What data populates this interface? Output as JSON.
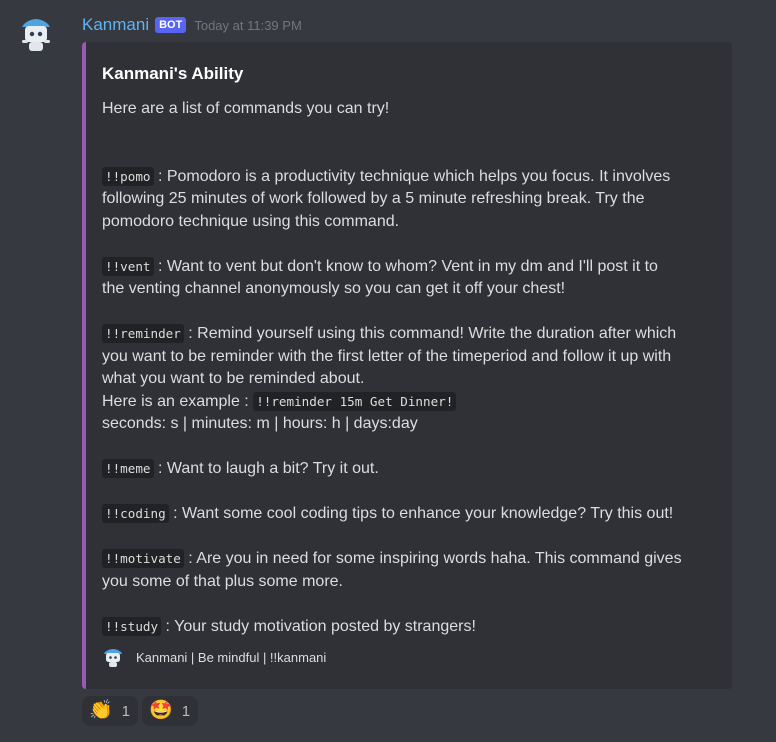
{
  "message": {
    "username": "Kanmani",
    "bot_tag": "BOT",
    "timestamp": "Today at 11:39 PM"
  },
  "embed": {
    "accent_color": "#9b59b6",
    "title": "Kanmani's Ability",
    "intro": "Here are a list of commands you can try!",
    "commands": [
      {
        "command": "!!pomo",
        "lines": [
          " : Pomodoro is a productivity technique which helps you focus. It involves",
          "following 25 minutes of work followed by a 5 minute refreshing break. Try the",
          "pomodoro technique using this command."
        ]
      },
      {
        "command": "!!vent",
        "lines": [
          " : Want to vent but don't know to whom? Vent in my dm and I'll post it to",
          "the venting channel anonymously so you can get it off your chest!"
        ]
      },
      {
        "command": "!!reminder",
        "lines": [
          " : Remind yourself using this command! Write the duration after which",
          "you want to be reminder with the first letter of the timeperiod and follow it up with",
          "what you want to be reminded about."
        ],
        "example_label": "Here is an example : ",
        "example_code": "!!reminder 15m Get Dinner!",
        "units": "seconds: s | minutes: m | hours: h | days:day"
      },
      {
        "command": "!!meme",
        "lines": [
          " : Want to laugh a bit? Try it out."
        ]
      },
      {
        "command": "!!coding",
        "lines": [
          " : Want some cool coding tips to enhance your knowledge? Try this out!"
        ]
      },
      {
        "command": "!!motivate",
        "lines": [
          " : Are you in need for some inspiring words haha. This command gives",
          "you some of that plus some more."
        ]
      },
      {
        "command": "!!study",
        "lines": [
          " : Your study motivation posted by strangers!"
        ]
      }
    ],
    "footer": "Kanmani | Be mindful | !!kanmani"
  },
  "reactions": [
    {
      "emoji": "👏",
      "emoji_name": "clapping-hands-icon",
      "count": "1"
    },
    {
      "emoji": "🤩",
      "emoji_name": "star-struck-icon",
      "count": "1"
    }
  ]
}
